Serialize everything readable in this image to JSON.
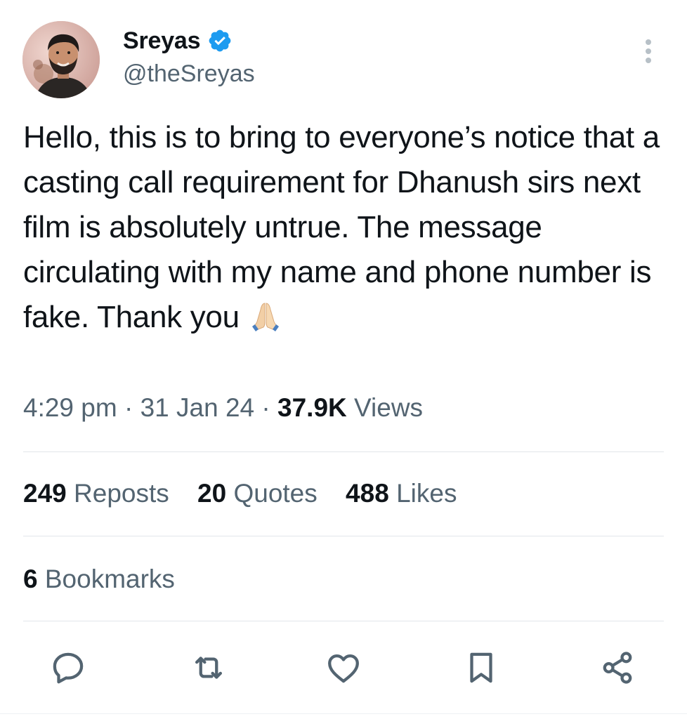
{
  "author": {
    "display_name": "Sreyas",
    "handle": "@theSreyas",
    "verified": true,
    "verified_color": "#1d9bf0",
    "avatar_icon": "profile-photo"
  },
  "tweet": {
    "text": "Hello, this is to bring to everyone’s notice that a casting call requirement for Dhanush sirs next film is absolutely untrue. The message circulating with my name and phone number is fake. Thank you",
    "emoji": "folded-hands"
  },
  "meta": {
    "time": "4:29 pm",
    "separator": "·",
    "date": "31 Jan 24",
    "views_count": "37.9K",
    "views_label": "Views"
  },
  "stats": {
    "reposts_count": "249",
    "reposts_label": "Reposts",
    "quotes_count": "20",
    "quotes_label": "Quotes",
    "likes_count": "488",
    "likes_label": "Likes",
    "bookmarks_count": "6",
    "bookmarks_label": "Bookmarks"
  },
  "actions": [
    {
      "name": "reply",
      "icon": "reply-icon"
    },
    {
      "name": "repost",
      "icon": "repost-icon"
    },
    {
      "name": "like",
      "icon": "heart-icon"
    },
    {
      "name": "bookmark",
      "icon": "bookmark-icon"
    },
    {
      "name": "share",
      "icon": "share-icon"
    }
  ],
  "colors": {
    "text_primary": "#0f1419",
    "text_secondary": "#536471",
    "accent": "#1d9bf0",
    "divider": "#e1e6ea"
  }
}
